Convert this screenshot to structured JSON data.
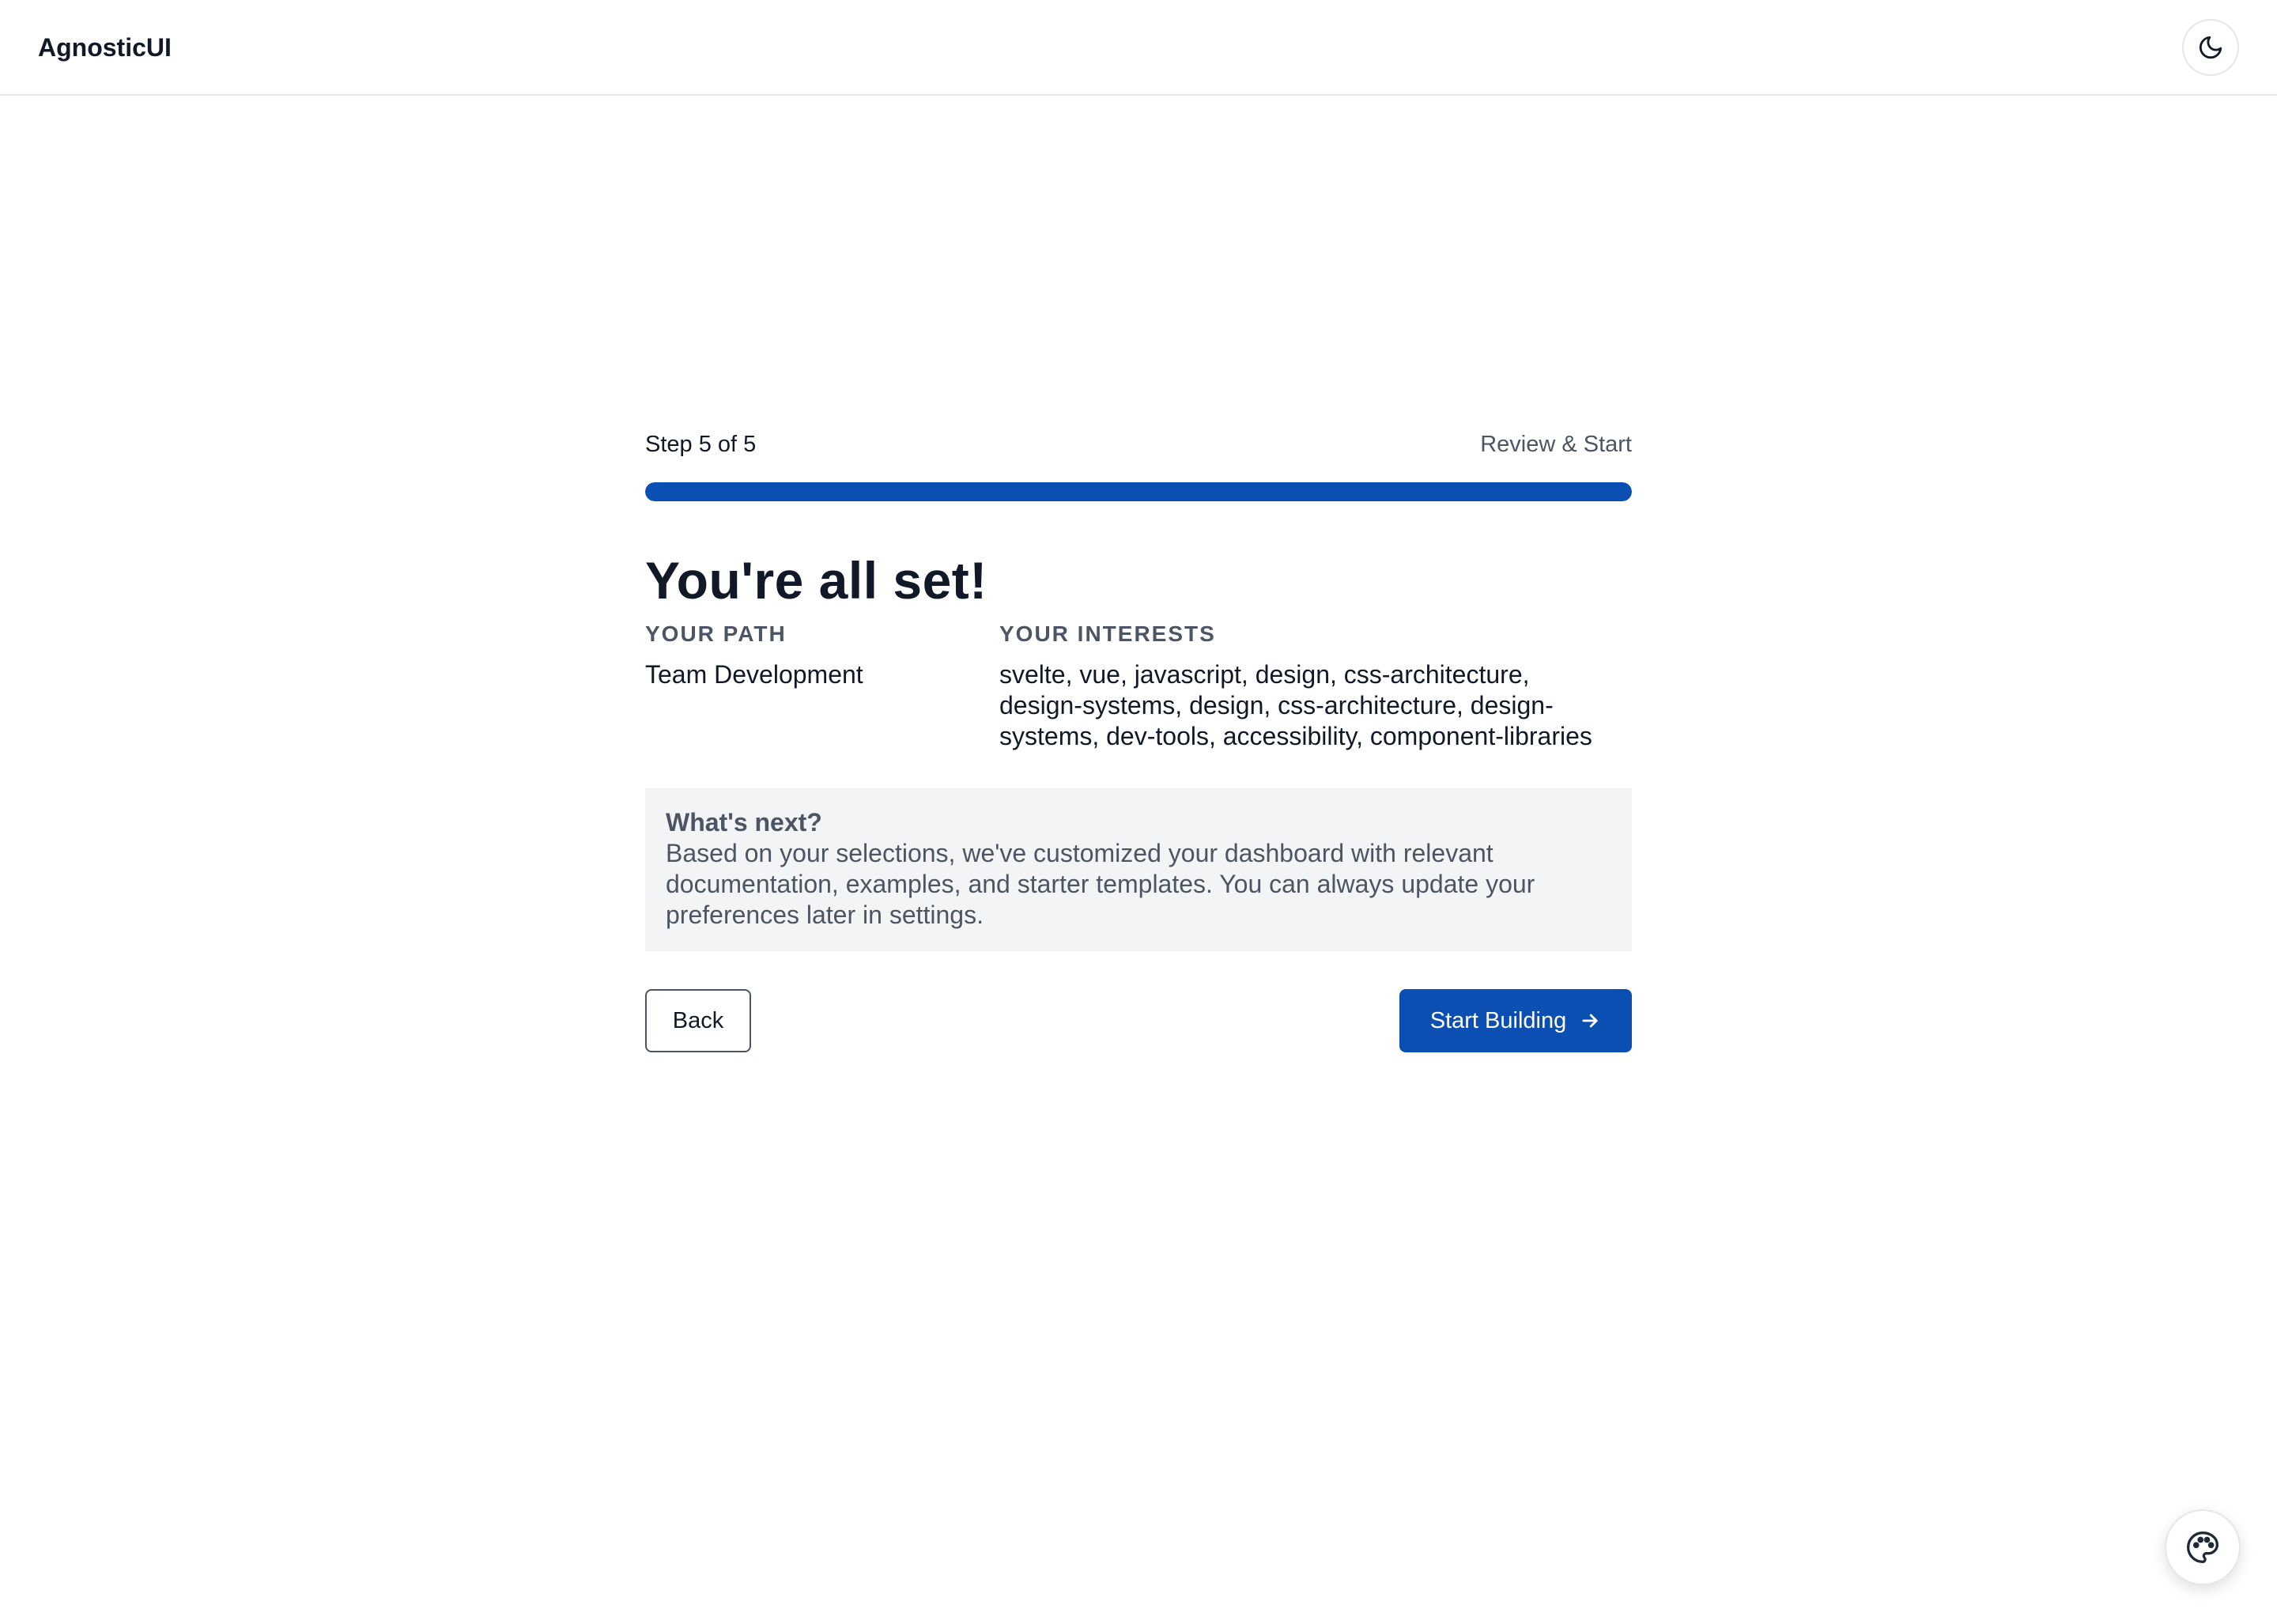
{
  "app": {
    "brand": "AgnosticUI",
    "theme_toggle_icon": "moon-icon",
    "theme_picker_icon": "palette-icon"
  },
  "wizard": {
    "step_label": "Step 5 of 5",
    "step_name": "Review & Start",
    "progress": 1.0,
    "headline": "You're all set!",
    "path_label": "YOUR PATH",
    "path_value": "Team Development",
    "interests_label": "YOUR INTERESTS",
    "interests_value": "svelte, vue, javascript, design, css-architecture, design-systems, design, css-architecture, design-systems, dev-tools, accessibility, component-libraries",
    "next_title": "What's next?",
    "next_body": "Based on your selections, we've customized your dashboard with relevant documentation, examples, and starter templates. You can always update your preferences later in settings.",
    "back_label": "Back",
    "start_label": "Start Building",
    "start_icon": "arrow-right-icon"
  },
  "colors": {
    "accent": "#0b4fb3",
    "muted_text": "#4b5563",
    "panel_bg": "#f3f4f6"
  }
}
